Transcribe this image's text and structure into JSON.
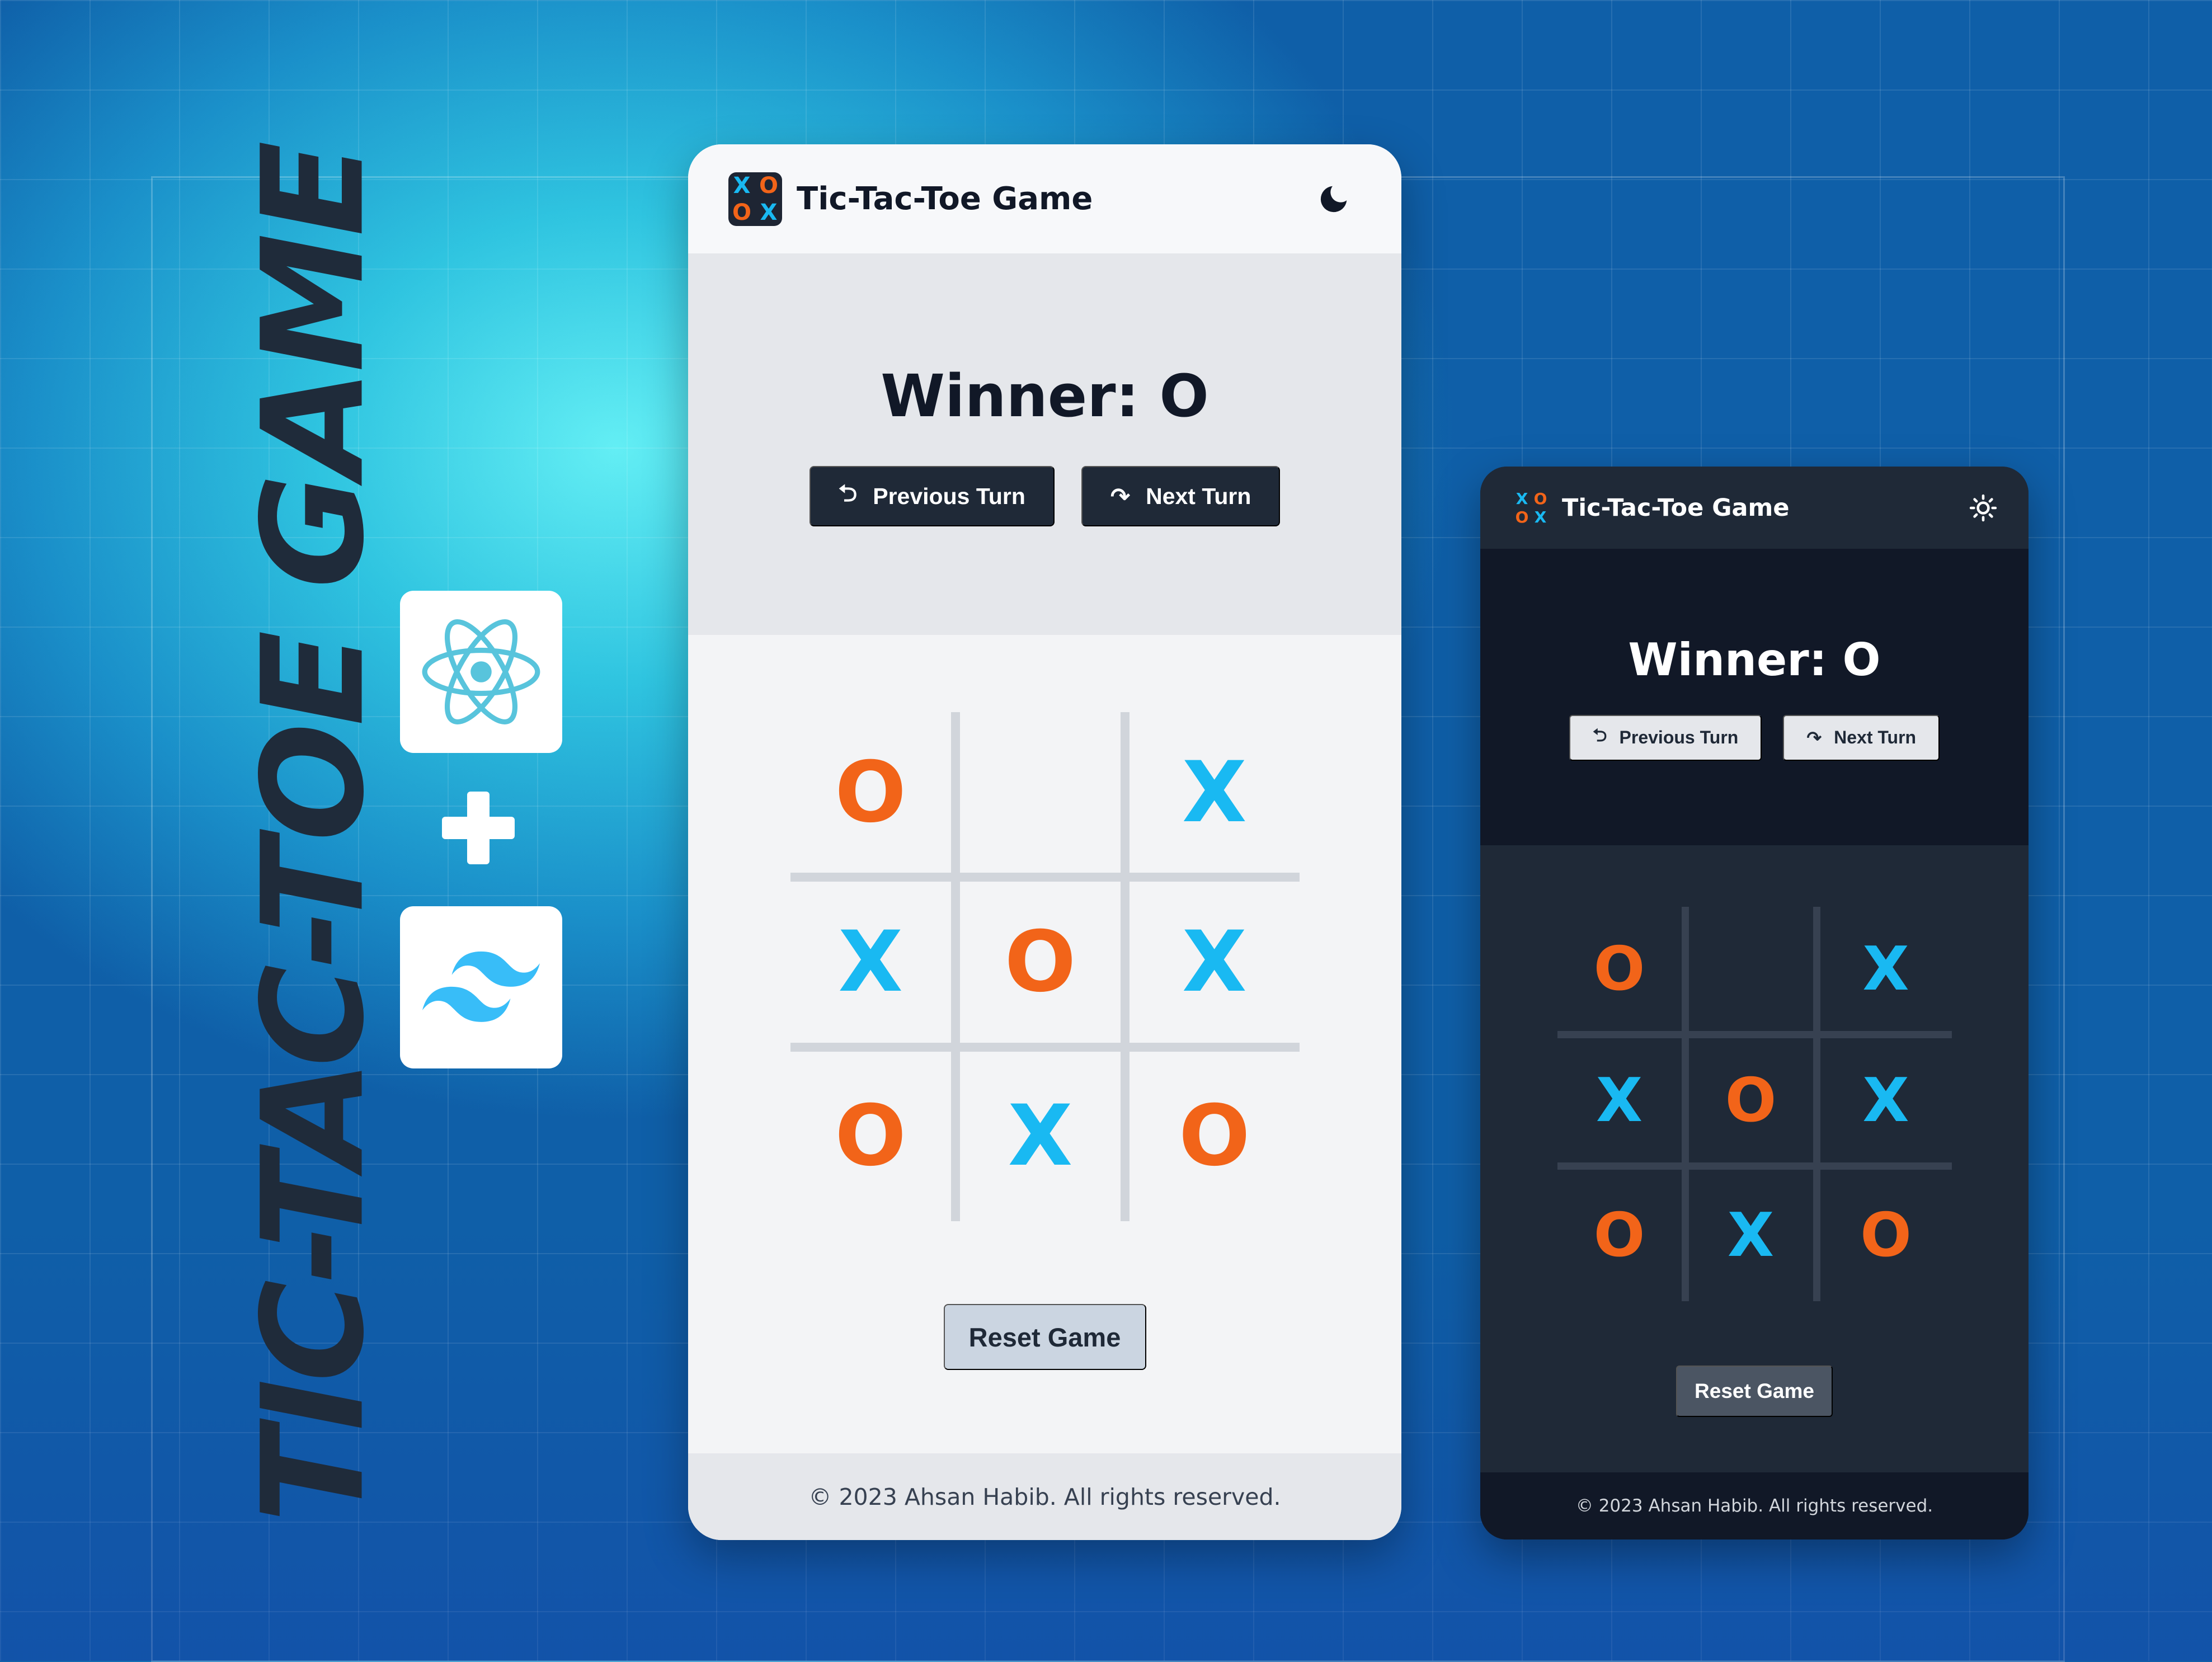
{
  "banner": {
    "title": "TIC-TAC-TOE GAME",
    "icons": [
      "react-icon",
      "tailwind-icon"
    ]
  },
  "app": {
    "title": "Tic-Tac-Toe Game",
    "logo": {
      "marks": [
        "X",
        "O",
        "O",
        "X"
      ]
    },
    "winner": "Winner: O",
    "previous_turn": "Previous Turn",
    "next_turn": "Next Turn",
    "board": [
      "O",
      "",
      "X",
      "X",
      "O",
      "X",
      "O",
      "X",
      "O"
    ],
    "reset": "Reset Game",
    "footer": "© 2023 Ahsan Habib. All rights reserved."
  },
  "themes": {
    "light": {
      "toggle_icon": "moon-icon"
    },
    "dark": {
      "toggle_icon": "sun-icon"
    }
  },
  "colors": {
    "x_mark": "#19b9f2",
    "o_mark": "#f26419",
    "dark_button": "#1f2937",
    "dark_surface": "#111827"
  }
}
